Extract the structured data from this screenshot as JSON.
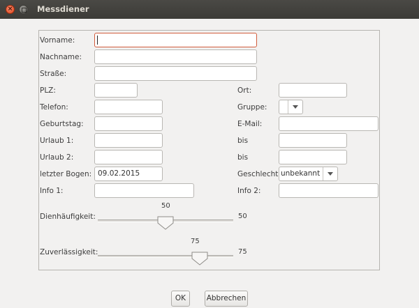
{
  "window": {
    "title": "Messdiener",
    "close_glyph": "×"
  },
  "labels": {
    "vorname": "Vorname:",
    "nachname": "Nachname:",
    "strasse": "Straße:",
    "plz": "PLZ:",
    "ort": "Ort:",
    "telefon": "Telefon:",
    "gruppe": "Gruppe:",
    "geburtstag": "Geburtstag:",
    "email": "E-Mail:",
    "urlaub1": "Urlaub 1:",
    "bis1": "bis",
    "urlaub2": "Urlaub 2:",
    "bis2": "bis",
    "letzter_bogen": "letzter Bogen:",
    "geschlecht": "Geschlecht:",
    "info1": "Info 1:",
    "info2": "Info 2:",
    "dienhaeufigkeit": "Dienhäufigkeit:",
    "zuverlaessigkeit": "Zuverlässigkeit:"
  },
  "fields": {
    "vorname": "",
    "nachname": "",
    "strasse": "",
    "plz": "",
    "ort": "",
    "telefon": "",
    "geburtstag": "",
    "email": "",
    "urlaub1_von": "",
    "urlaub1_bis": "",
    "urlaub2_von": "",
    "urlaub2_bis": "",
    "letzter_bogen": "09.02.2015",
    "info1": "",
    "info2": ""
  },
  "combos": {
    "gruppe": "",
    "geschlecht": "unbekannt"
  },
  "sliders": {
    "dienhaeufigkeit": {
      "value": "50",
      "value_right": "50",
      "fraction": 0.5
    },
    "zuverlaessigkeit": {
      "value": "75",
      "value_right": "75",
      "fraction": 0.75
    }
  },
  "buttons": {
    "ok": "OK",
    "abbrechen": "Abbrechen"
  },
  "icons": {
    "close": "close-icon",
    "minimize": "minimize-icon",
    "dropdown": "chevron-down-icon",
    "slider_thumb": "slider-thumb-icon"
  }
}
